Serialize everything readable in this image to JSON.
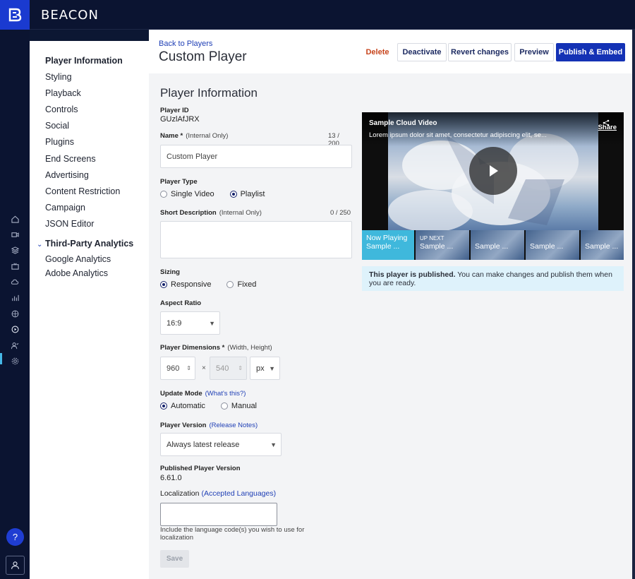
{
  "app": {
    "brand": "BEACON"
  },
  "sidebar": {
    "items": [
      {
        "label": "Player Information",
        "active": true
      },
      {
        "label": "Styling"
      },
      {
        "label": "Playback"
      },
      {
        "label": "Controls"
      },
      {
        "label": "Social"
      },
      {
        "label": "Plugins"
      },
      {
        "label": "End Screens"
      },
      {
        "label": "Advertising"
      },
      {
        "label": "Content Restriction"
      },
      {
        "label": "Campaign"
      },
      {
        "label": "JSON Editor"
      }
    ],
    "section": {
      "label": "Third-Party Analytics",
      "items": [
        "Google Analytics",
        "Adobe Analytics"
      ]
    }
  },
  "header": {
    "back_link": "Back to Players",
    "title": "Custom Player",
    "buttons": {
      "delete": "Delete",
      "deactivate": "Deactivate",
      "revert": "Revert changes",
      "preview": "Preview",
      "publish": "Publish & Embed"
    }
  },
  "form": {
    "section_title": "Player Information",
    "player_id_label": "Player ID",
    "player_id": "GUzlAfJRX",
    "name_label": "Name *",
    "name_sub": "(Internal Only)",
    "name_counter": "13 / 200",
    "name_value": "Custom Player",
    "type_label": "Player Type",
    "type_options": [
      "Single Video",
      "Playlist"
    ],
    "type_selected": "Playlist",
    "desc_label": "Short Description",
    "desc_sub": "(Internal Only)",
    "desc_counter": "0 / 250",
    "sizing_label": "Sizing",
    "sizing_options": [
      "Responsive",
      "Fixed"
    ],
    "sizing_selected": "Responsive",
    "aspect_label": "Aspect Ratio",
    "aspect_value": "16:9",
    "dims_label": "Player Dimensions *",
    "dims_sub": "(Width, Height)",
    "width": "960",
    "height": "540",
    "dims_sep": "×",
    "unit": "px",
    "update_label": "Update Mode",
    "update_link": "(What's this?)",
    "update_options": [
      "Automatic",
      "Manual"
    ],
    "update_selected": "Automatic",
    "version_label": "Player Version",
    "version_link": "(Release Notes)",
    "version_value": "Always latest release",
    "published_label": "Published Player Version",
    "published_value": "6.61.0",
    "loc_label": "Localization",
    "loc_link": "(Accepted Languages)",
    "loc_hint": "Include the language code(s) you wish to use for localization",
    "save_label": "Save"
  },
  "preview": {
    "video_title": "Sample Cloud Video",
    "video_desc": "Lorem ipsum dolor sit amet, consectetur adipiscing elit, se...",
    "share": "Share",
    "thumbs": [
      {
        "line1": "Now Playing",
        "line2": "Sample ..."
      },
      {
        "line1": "UP NEXT",
        "line2": "Sample ..."
      },
      {
        "line1": "",
        "line2": "Sample ..."
      },
      {
        "line1": "",
        "line2": "Sample ..."
      },
      {
        "line1": "",
        "line2": "Sample ..."
      }
    ],
    "status_bold": "This player is published.",
    "status_text": " You can make changes and publish them when you are ready."
  },
  "colors": {
    "brand_blue": "#1432b5",
    "accent_cyan": "#3fb8dc",
    "danger": "#c7441c",
    "dark_nav": "#0b1431"
  },
  "icons": [
    "home-icon",
    "video-icon",
    "layers-icon",
    "tv-icon",
    "cloud-icon",
    "analytics-icon",
    "globe-icon",
    "player-icon",
    "users-icon",
    "gear-icon"
  ]
}
